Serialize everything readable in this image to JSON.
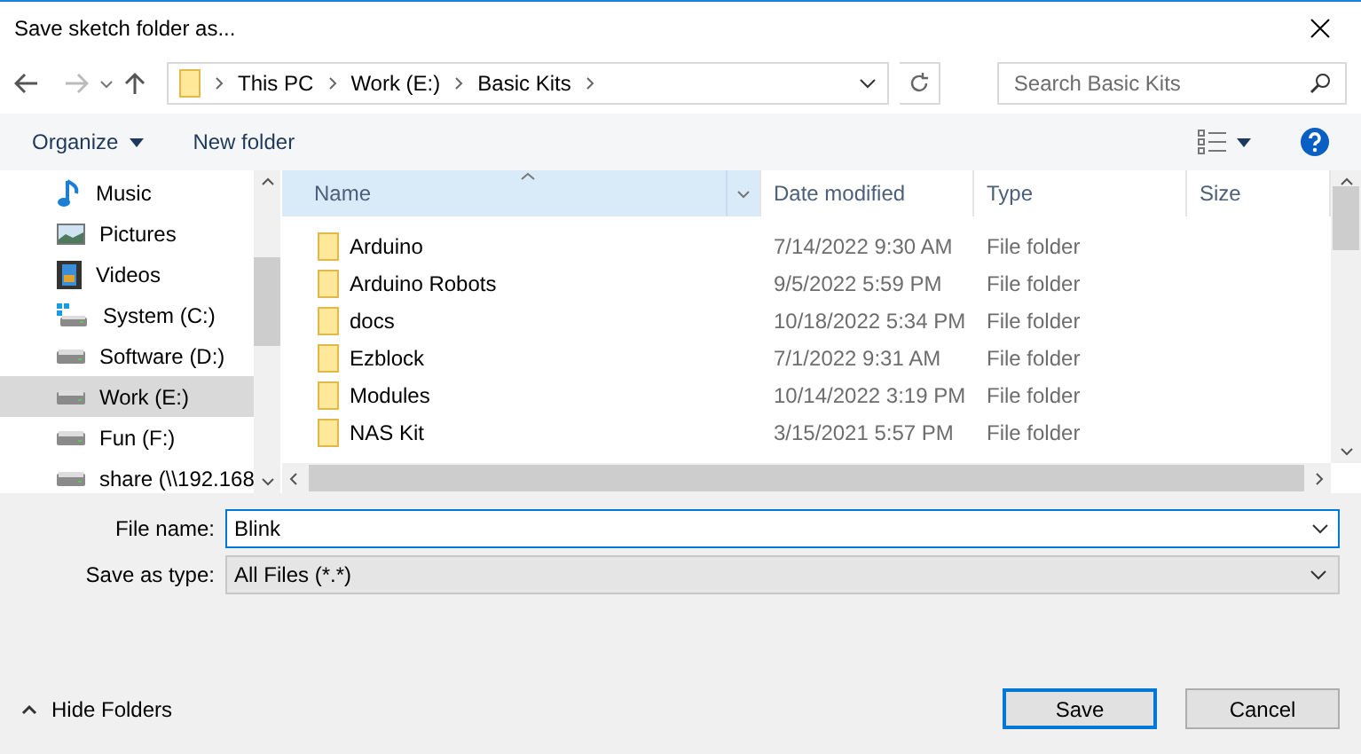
{
  "window": {
    "title": "Save sketch folder as..."
  },
  "address": {
    "crumbs": [
      "This PC",
      "Work (E:)",
      "Basic Kits"
    ]
  },
  "search": {
    "placeholder": "Search Basic Kits"
  },
  "toolbar": {
    "organize": "Organize",
    "new_folder": "New folder"
  },
  "sidebar": {
    "items": [
      {
        "label": "Music",
        "kind": "music",
        "selected": false
      },
      {
        "label": "Pictures",
        "kind": "pictures",
        "selected": false
      },
      {
        "label": "Videos",
        "kind": "videos",
        "selected": false
      },
      {
        "label": "System (C:)",
        "kind": "system",
        "selected": false
      },
      {
        "label": "Software (D:)",
        "kind": "drive",
        "selected": false
      },
      {
        "label": "Work (E:)",
        "kind": "drive",
        "selected": true
      },
      {
        "label": "Fun (F:)",
        "kind": "drive",
        "selected": false
      },
      {
        "label": "share (\\\\192.168",
        "kind": "drive",
        "selected": false
      }
    ]
  },
  "table": {
    "columns": [
      {
        "label": "Name",
        "sorted": true
      },
      {
        "label": "Date modified",
        "sorted": false
      },
      {
        "label": "Type",
        "sorted": false
      },
      {
        "label": "Size",
        "sorted": false
      }
    ],
    "rows": [
      {
        "name": "Arduino",
        "date": "7/14/2022 9:30 AM",
        "type": "File folder"
      },
      {
        "name": "Arduino Robots",
        "date": "9/5/2022 5:59 PM",
        "type": "File folder"
      },
      {
        "name": "docs",
        "date": "10/18/2022 5:34 PM",
        "type": "File folder"
      },
      {
        "name": "Ezblock",
        "date": "7/1/2022 9:31 AM",
        "type": "File folder"
      },
      {
        "name": "Modules",
        "date": "10/14/2022 3:19 PM",
        "type": "File folder"
      },
      {
        "name": "NAS Kit",
        "date": "3/15/2021 5:57 PM",
        "type": "File folder"
      }
    ]
  },
  "form": {
    "file_name_label": "File name:",
    "file_name": "Blink",
    "type_label": "Save as type:",
    "type_value": "All Files (*.*)"
  },
  "footer": {
    "hide_folders": "Hide Folders",
    "buttons": [
      {
        "label": "Save",
        "selected": true
      },
      {
        "label": "Cancel",
        "selected": false
      }
    ]
  }
}
